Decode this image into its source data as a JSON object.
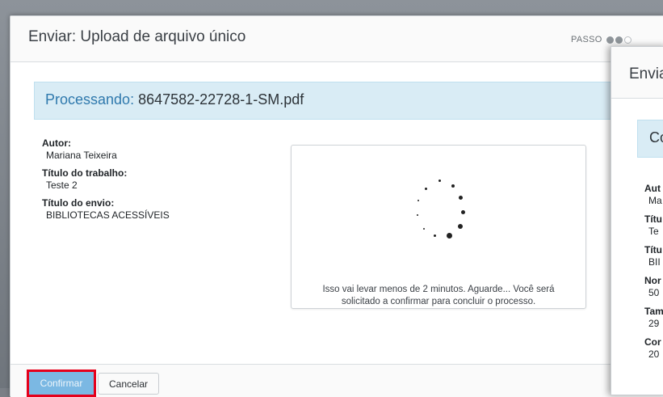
{
  "main_modal": {
    "title": "Enviar: Upload de arquivo único",
    "step_label": "PASSO",
    "step_dots": [
      "on",
      "on",
      "off"
    ]
  },
  "processing": {
    "label": "Processando:",
    "filename": "8647582-22728-1-SM.pdf"
  },
  "metadata": [
    {
      "label": "Autor:",
      "value": "Mariana Teixeira"
    },
    {
      "label": "Título do trabalho:",
      "value": "Teste 2"
    },
    {
      "label": "Título do envio:",
      "value": "BIBLIOTECAS ACESSÍVEIS"
    }
  ],
  "spinner_card": {
    "message": "Isso vai levar menos de 2 minutos. Aguarde... Você será solicitado a confirmar para concluir o processo."
  },
  "footer": {
    "confirm_label": "Confirmar",
    "cancel_label": "Cancelar"
  },
  "second_modal": {
    "title": "Envia",
    "bar_text": "Co",
    "items": [
      {
        "label": "Aut",
        "value": "Ma"
      },
      {
        "label": "Títu",
        "value": "Te"
      },
      {
        "label": "Títu",
        "value": "BII"
      },
      {
        "label": "Nor",
        "value": "50"
      },
      {
        "label": "Tam",
        "value": "29"
      },
      {
        "label": "Cor",
        "value": "20"
      }
    ]
  },
  "colors": {
    "accent": "#2f79ad",
    "highlight_box": "#e5001b",
    "confirm_button": "#7bb8e3",
    "info_bar": "#d9ecf5"
  }
}
